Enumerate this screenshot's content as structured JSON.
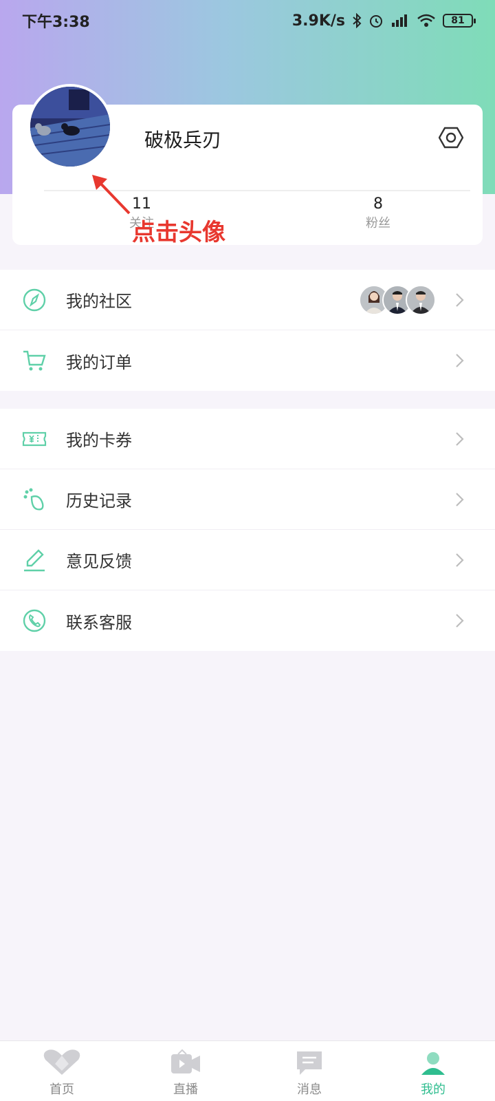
{
  "status_bar": {
    "time": "下午3:38",
    "net_speed": "3.9K/s",
    "battery": "81"
  },
  "profile": {
    "username": "破极兵刃",
    "follow_count": "11",
    "follow_label": "关注",
    "fans_count": "8",
    "fans_label": "粉丝"
  },
  "annotation": "点击头像",
  "menu_group_1": [
    {
      "label": "我的社区",
      "icon": "compass-icon"
    },
    {
      "label": "我的订单",
      "icon": "cart-icon"
    }
  ],
  "menu_group_2": [
    {
      "label": "我的卡券",
      "icon": "ticket-icon"
    },
    {
      "label": "历史记录",
      "icon": "footprint-icon"
    },
    {
      "label": "意见反馈",
      "icon": "pencil-icon"
    },
    {
      "label": "联系客服",
      "icon": "phone-icon"
    }
  ],
  "tabbar": [
    {
      "label": "首页",
      "icon": "heart-home-icon"
    },
    {
      "label": "直播",
      "icon": "video-icon"
    },
    {
      "label": "消息",
      "icon": "message-icon"
    },
    {
      "label": "我的",
      "icon": "profile-icon",
      "active": true
    }
  ],
  "colors": {
    "accent": "#2fbd8f",
    "annotation_red": "#e8382f",
    "gradient_left": "#b9a7ee",
    "gradient_right": "#7fdcb8"
  }
}
